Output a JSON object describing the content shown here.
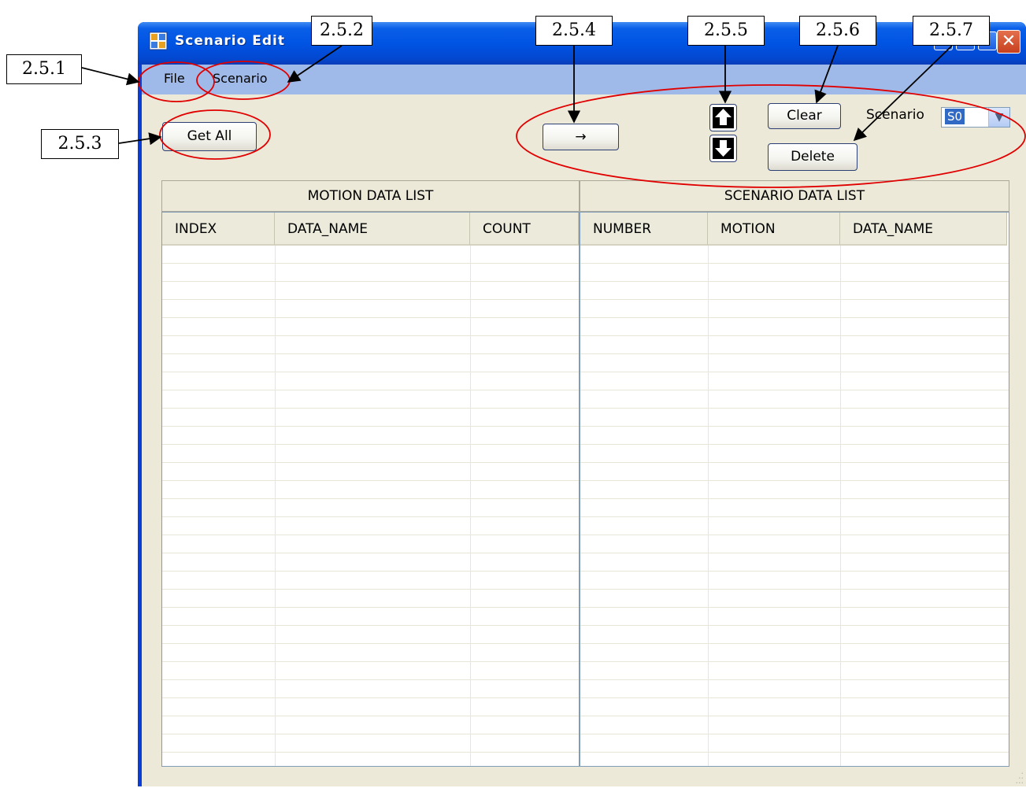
{
  "window": {
    "title": "Scenario Edit",
    "close_glyph": "✕"
  },
  "menu": {
    "file": "File",
    "scenario": "Scenario"
  },
  "toolbar": {
    "get_all": "Get All",
    "transfer": "→",
    "clear": "Clear",
    "delete": "Delete",
    "scenario_label": "Scenario",
    "scenario_value": "S0",
    "up_icon": "arrow-up-icon",
    "down_icon": "arrow-down-icon"
  },
  "motion_list": {
    "title": "MOTION DATA LIST",
    "columns": [
      "INDEX",
      "DATA_NAME",
      "COUNT"
    ]
  },
  "scenario_list": {
    "title": "SCENARIO DATA LIST",
    "columns": [
      "NUMBER",
      "MOTION",
      "DATA_NAME"
    ]
  },
  "annotations": {
    "a1": "2.5.1",
    "a2": "2.5.2",
    "a3": "2.5.3",
    "a4": "2.5.4",
    "a5": "2.5.5",
    "a6": "2.5.6",
    "a7": "2.5.7"
  },
  "colors": {
    "annotation": "#e00000",
    "titlebar": "#0054e3",
    "menubar": "#9fb9e8",
    "client": "#ece9d8"
  }
}
